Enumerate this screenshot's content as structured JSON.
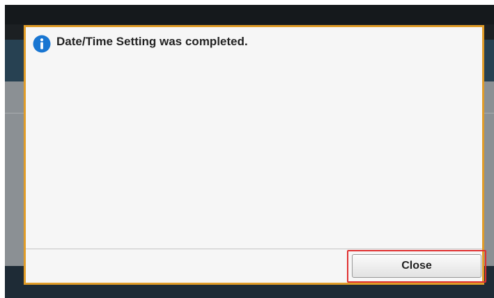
{
  "dialog": {
    "icon": "info-icon",
    "message": "Date/Time Setting was completed.",
    "close_label": "Close"
  },
  "colors": {
    "dialog_border": "#e09c28",
    "highlight": "#e03030",
    "info_icon": "#1976d2"
  }
}
